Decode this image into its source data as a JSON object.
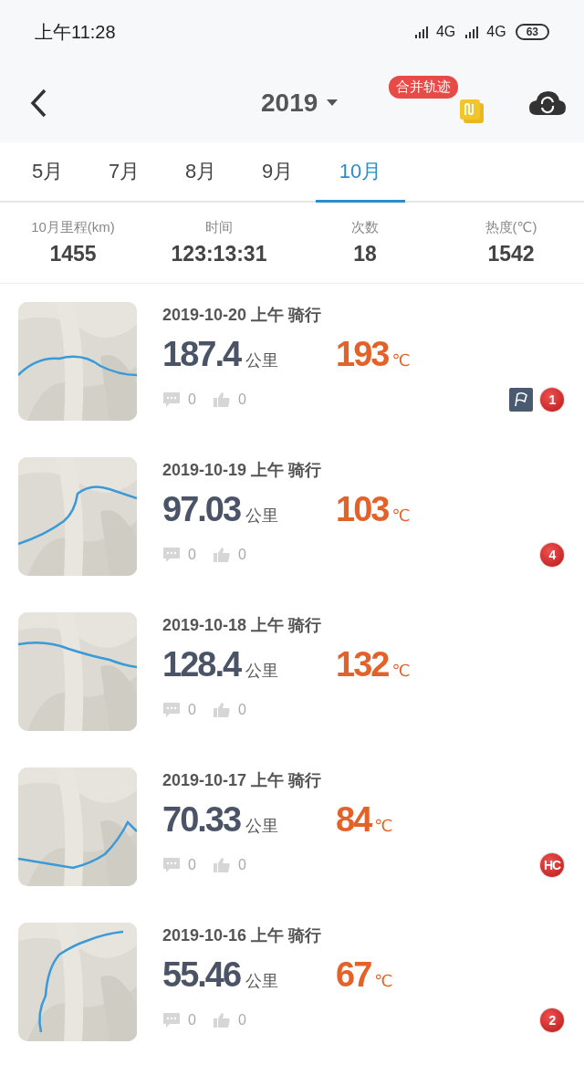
{
  "status_bar": {
    "time": "上午11:28",
    "network_1": "4G",
    "network_2": "4G",
    "battery": "63"
  },
  "header": {
    "year": "2019",
    "merge_label": "合并轨迹"
  },
  "tabs": [
    {
      "label": "5月",
      "selected": false
    },
    {
      "label": "7月",
      "selected": false
    },
    {
      "label": "8月",
      "selected": false
    },
    {
      "label": "9月",
      "selected": false
    },
    {
      "label": "10月",
      "selected": true
    }
  ],
  "stats": [
    {
      "label": "10月里程(km)",
      "value": "1455"
    },
    {
      "label": "时间",
      "value": "123:13:31"
    },
    {
      "label": "次数",
      "value": "18"
    },
    {
      "label": "热度(℃)",
      "value": "1542"
    }
  ],
  "rides": [
    {
      "title": "2019-10-20 上午 骑行",
      "distance": "187.4",
      "distance_unit": "公里",
      "heat": "193",
      "heat_unit": "℃",
      "comments": "0",
      "likes": "0",
      "badges": [
        {
          "kind": "flag"
        },
        {
          "kind": "medal",
          "text": "1"
        }
      ]
    },
    {
      "title": "2019-10-19 上午 骑行",
      "distance": "97.03",
      "distance_unit": "公里",
      "heat": "103",
      "heat_unit": "℃",
      "comments": "0",
      "likes": "0",
      "badges": [
        {
          "kind": "medal",
          "text": "4"
        }
      ]
    },
    {
      "title": "2019-10-18 上午 骑行",
      "distance": "128.4",
      "distance_unit": "公里",
      "heat": "132",
      "heat_unit": "℃",
      "comments": "0",
      "likes": "0"
    },
    {
      "title": "2019-10-17 上午 骑行",
      "distance": "70.33",
      "distance_unit": "公里",
      "heat": "84",
      "heat_unit": "℃",
      "comments": "0",
      "likes": "0",
      "badges": [
        {
          "kind": "medal",
          "text": "HC"
        }
      ]
    },
    {
      "title": "2019-10-16 上午 骑行",
      "distance": "55.46",
      "distance_unit": "公里",
      "heat": "67",
      "heat_unit": "℃",
      "comments": "0",
      "likes": "0",
      "badges": [
        {
          "kind": "medal",
          "text": "2"
        }
      ]
    }
  ]
}
